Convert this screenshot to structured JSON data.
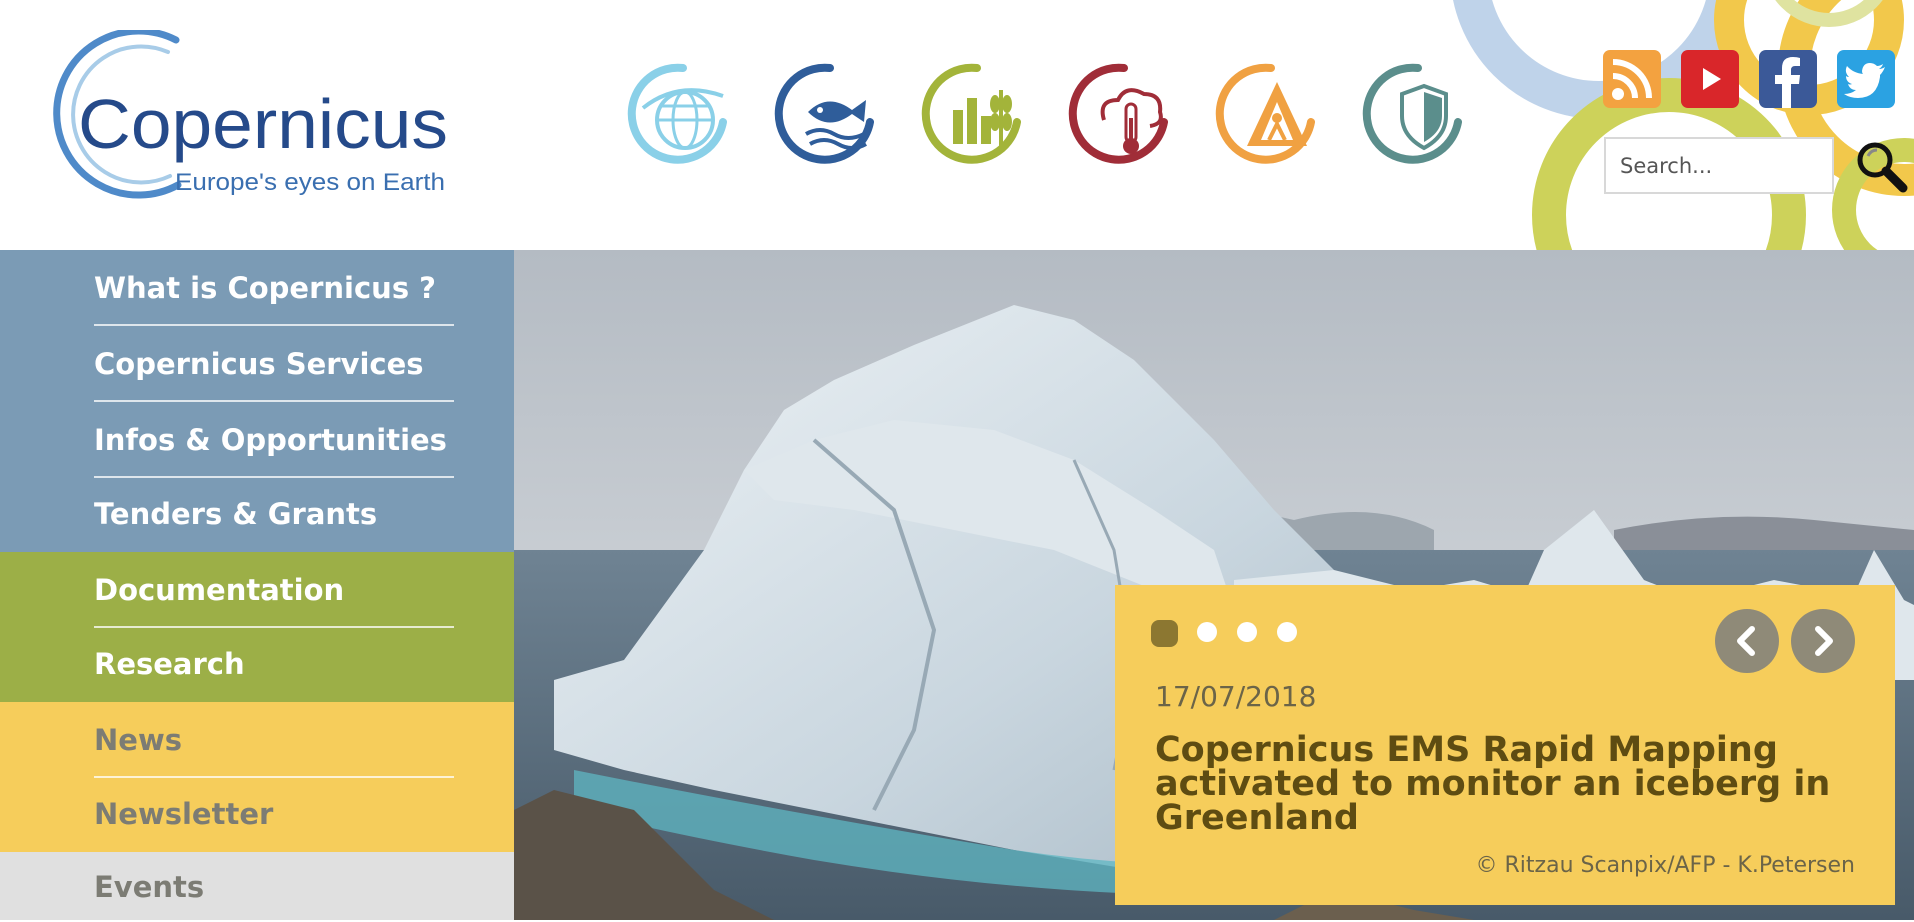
{
  "logo": {
    "name": "Copernicus",
    "tagline": "Europe's eyes on Earth"
  },
  "services": [
    {
      "name": "atmosphere",
      "color": "#8ad0e8"
    },
    {
      "name": "marine",
      "color": "#2f5d9a"
    },
    {
      "name": "land",
      "color": "#a3b43a"
    },
    {
      "name": "climate-change",
      "color": "#a02d38"
    },
    {
      "name": "emergency",
      "color": "#f0a142"
    },
    {
      "name": "security",
      "color": "#5b8e8c"
    }
  ],
  "social": [
    {
      "name": "rss",
      "color": "#f3a240"
    },
    {
      "name": "youtube",
      "color": "#d9262a"
    },
    {
      "name": "facebook",
      "color": "#3b5998"
    },
    {
      "name": "twitter",
      "color": "#2ba2e2"
    }
  ],
  "search": {
    "placeholder": "Search..."
  },
  "nav": {
    "what": "What is Copernicus ?",
    "services": "Copernicus Services",
    "infos": "Infos & Opportunities",
    "tenders": "Tenders & Grants",
    "documentation": "Documentation",
    "research": "Research",
    "news": "News",
    "newsletter": "Newsletter",
    "events": "Events"
  },
  "slider": {
    "slide_count": 4,
    "active_slide": 1,
    "date": "17/07/2018",
    "title": "Copernicus EMS Rapid Mapping activated to monitor an iceberg in Greenland",
    "credit": "© Ritzau Scanpix/AFP - K.Petersen"
  },
  "colors": {
    "nav_blue": "#7b9bb5",
    "nav_green": "#9caf47",
    "nav_yellow": "#f6cd5b",
    "nav_grey": "#e0e0e0",
    "caption_bg": "#f6cd5b",
    "caption_title": "#5e4c12"
  }
}
